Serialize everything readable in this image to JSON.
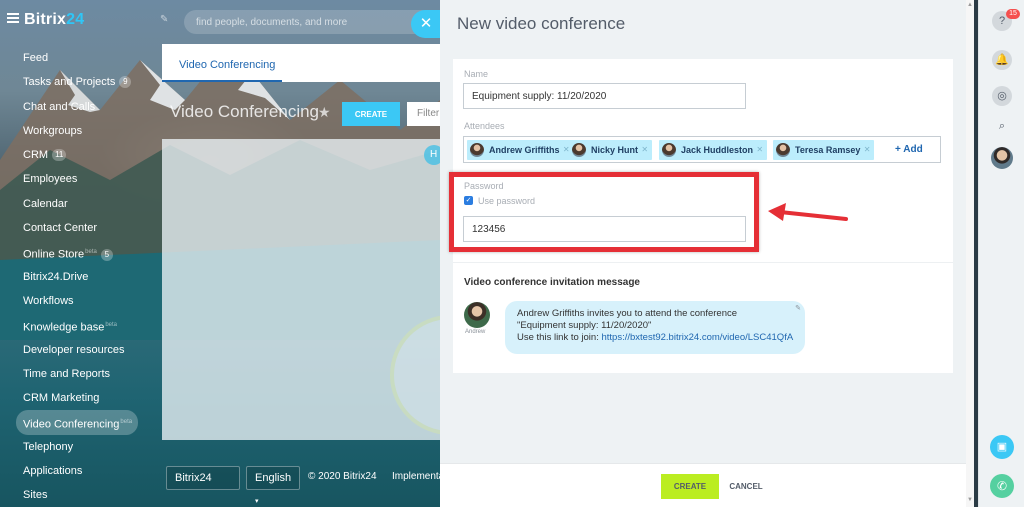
{
  "portal": {
    "logo_text": "Bitrix",
    "logo_num": "24",
    "search_placeholder": "find people, documents, and more",
    "menu": [
      {
        "label": "Feed"
      },
      {
        "label": "Tasks and Projects",
        "badge": "9"
      },
      {
        "label": "Chat and Calls"
      },
      {
        "label": "Workgroups"
      },
      {
        "label": "CRM",
        "badge": "11"
      },
      {
        "label": "Employees"
      },
      {
        "label": "Calendar"
      },
      {
        "label": "Contact Center"
      },
      {
        "label": "Online Store",
        "sup": "beta",
        "badge": "5"
      },
      {
        "label": "Bitrix24.Drive"
      },
      {
        "label": "Workflows"
      },
      {
        "label": "Knowledge base",
        "sup": "beta"
      },
      {
        "label": "Developer resources"
      },
      {
        "label": "Time and Reports"
      },
      {
        "label": "CRM Marketing"
      },
      {
        "label": "Video Conferencing",
        "sup": "beta",
        "active": true
      },
      {
        "label": "Telephony"
      },
      {
        "label": "Applications"
      },
      {
        "label": "Sites"
      }
    ],
    "work_tab": "Video Conferencing",
    "work_title": "Video Conferencing",
    "create_label": "CREATE",
    "filter_text": "Filter",
    "footer": {
      "brand": "Bitrix24",
      "language": "English",
      "copyright": "© 2020 Bitrix24",
      "implementation": "Implementa"
    }
  },
  "slider": {
    "title": "New video conference",
    "name_label": "Name",
    "name_value": "Equipment supply: 11/20/2020",
    "attendees_label": "Attendees",
    "attendees": [
      {
        "name": "Andrew Griffiths"
      },
      {
        "name": "Nicky Hunt"
      },
      {
        "name": "Jack Huddleston"
      },
      {
        "name": "Teresa Ramsey"
      }
    ],
    "add_label": "+ Add",
    "password_label": "Password",
    "use_password_label": "Use password",
    "use_password_checked": true,
    "password_value": "123456",
    "invite_title": "Video conference invitation message",
    "invite_avatar_name": "Andrew",
    "invite_line1": "Andrew Griffiths invites you to attend the conference",
    "invite_line2": "\"Equipment supply: 11/20/2020\"",
    "invite_line3_prefix": "Use this link to join: ",
    "invite_link": "https://bxtest92.bitrix24.com/video/LSC41QfA",
    "create_label": "CREATE",
    "cancel_label": "CANCEL"
  },
  "right_bar": {
    "notification_count": "15"
  },
  "colors": {
    "accent": "#3bc8f5",
    "create_green": "#bbed21",
    "tag_bg": "#bcedfc",
    "annotation_red": "#e52f36"
  }
}
